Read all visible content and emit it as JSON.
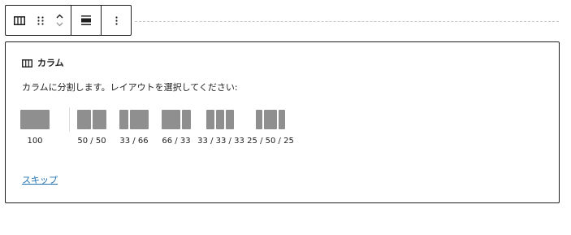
{
  "toolbar": {
    "block_icon": "columns-icon",
    "drag_icon": "drag-handle-icon",
    "move_up_icon": "chevron-up-icon",
    "move_down_icon": "chevron-down-icon",
    "align_icon": "align-wide-icon",
    "options_icon": "more-vertical-icon"
  },
  "placeholder": {
    "title": "カラム",
    "title_icon": "columns-icon",
    "instructions": "カラムに分割します。レイアウトを選択してください:",
    "variations": [
      {
        "label": "100",
        "columns": [
          100
        ]
      },
      {
        "label": "50 / 50",
        "columns": [
          50,
          50
        ]
      },
      {
        "label": "33 / 66",
        "columns": [
          33,
          66
        ]
      },
      {
        "label": "66 / 33",
        "columns": [
          66,
          33
        ]
      },
      {
        "label": "33 / 33 / 33",
        "columns": [
          33,
          33,
          33
        ]
      },
      {
        "label": "25 / 50 / 25",
        "columns": [
          25,
          50,
          25
        ]
      }
    ],
    "skip_label": "スキップ"
  },
  "colors": {
    "border": "#1e1e1e",
    "thumb": "#8f8f8f",
    "link": "#2271b1",
    "dashed": "#c7c7c7"
  }
}
